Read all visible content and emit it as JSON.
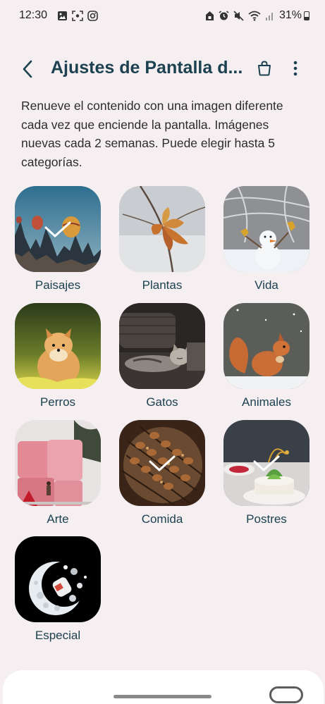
{
  "status_bar": {
    "time": "12:30",
    "battery": "31%",
    "battery_level": 0.31,
    "left_icons": [
      "gallery-icon",
      "screenshot-icon",
      "instagram-icon"
    ],
    "right_icons": [
      "home-lock-icon",
      "alarm-icon",
      "mute-icon",
      "wifi-icon",
      "signal-icon",
      "battery-icon"
    ]
  },
  "header": {
    "title": "Ajustes de Pantalla d...",
    "back_icon": "chevron-left-icon",
    "store_icon": "shopping-bag-icon",
    "more_icon": "more-vert-icon"
  },
  "description": "Renueve el contenido con una imagen diferente cada vez que enciende la pantalla. Imágenes nuevas cada 2 semanas. Puede elegir hasta 5 categorías.",
  "categories": [
    {
      "label": "Paisajes",
      "selected": true
    },
    {
      "label": "Plantas",
      "selected": false
    },
    {
      "label": "Vida",
      "selected": false
    },
    {
      "label": "Perros",
      "selected": false
    },
    {
      "label": "Gatos",
      "selected": false
    },
    {
      "label": "Animales",
      "selected": false
    },
    {
      "label": "Arte",
      "selected": false
    },
    {
      "label": "Comida",
      "selected": true
    },
    {
      "label": "Postres",
      "selected": true
    },
    {
      "label": "Especial",
      "selected": false
    }
  ],
  "colors": {
    "accent": "#1c4150",
    "background": "#f6eff1"
  }
}
